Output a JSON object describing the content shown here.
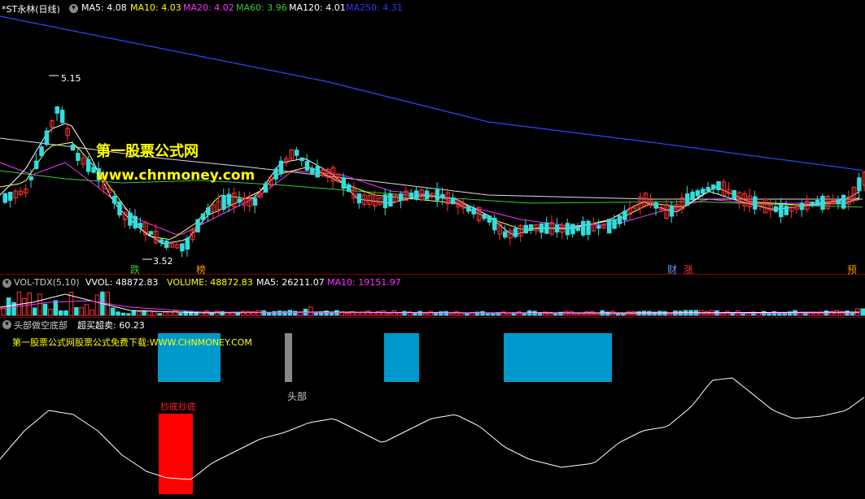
{
  "panel1": {
    "title": "*ST永林(日线)",
    "ma": [
      {
        "label": "MA5: 4.08",
        "color": "#ffffff"
      },
      {
        "label": "MA10: 4.03",
        "color": "#ffff00"
      },
      {
        "label": "MA20: 4.02",
        "color": "#ff33ff"
      },
      {
        "label": "MA60: 3.96",
        "color": "#33cc33"
      },
      {
        "label": "MA120: 4.01",
        "color": "#ffffff"
      },
      {
        "label": "MA250: 4.31",
        "color": "#3333ff"
      }
    ],
    "high_label": "5.15",
    "low_label": "3.52",
    "watermark1": "第一股票公式网",
    "watermark2": "www.chnmoney.com",
    "markers": [
      {
        "text": "跌",
        "color": "#33cc33"
      },
      {
        "text": "榜",
        "color": "#ff9900"
      },
      {
        "text": "财",
        "color": "#6699ff"
      },
      {
        "text": "涨",
        "color": "#ff3333"
      },
      {
        "text": "预",
        "color": "#ff9900"
      }
    ]
  },
  "panel2": {
    "labels": [
      {
        "text": "VOL-TDX(5,10)",
        "color": "#cccccc"
      },
      {
        "text": "VVOL: 48872.83",
        "color": "#ffffff"
      },
      {
        "text": "VOLUME: 48872.83",
        "color": "#ffff00"
      },
      {
        "text": "MA5: 26211.07",
        "color": "#ffffff"
      },
      {
        "text": "MA10: 19151.97",
        "color": "#ff33ff"
      }
    ]
  },
  "panel3": {
    "title": "头部做空底部",
    "value_label": "超买超卖: 60.23",
    "promo": "第一股票公式网股票公式免费下载:WWW.CHNMONEY.COM",
    "head_label": "头部",
    "bottom_label": "抄底抄底"
  },
  "chart_data": [
    {
      "type": "candlestick",
      "title": "*ST永林(日线)",
      "high": 5.15,
      "low": 3.52,
      "ma_current": {
        "MA5": 4.08,
        "MA10": 4.03,
        "MA20": 4.02,
        "MA60": 3.96,
        "MA120": 4.01,
        "MA250": 4.31
      }
    },
    {
      "type": "bar",
      "title": "VOL-TDX(5,10)",
      "last": {
        "VVOL": 48872.83,
        "VOLUME": 48872.83,
        "MA5": 26211.07,
        "MA10": 19151.97
      }
    },
    {
      "type": "line",
      "title": "头部做空底部",
      "last": {
        "超买超卖": 60.23
      }
    }
  ]
}
